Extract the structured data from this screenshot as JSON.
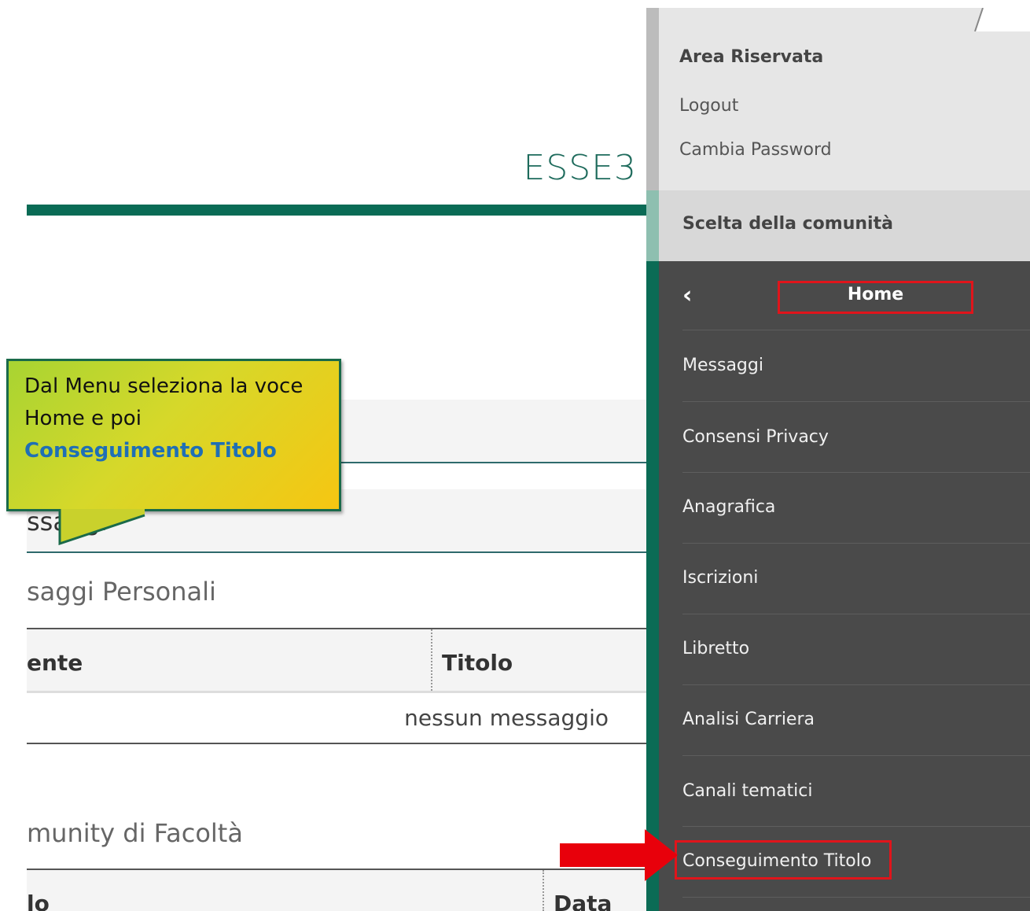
{
  "header": {
    "site_title": "ESSE3"
  },
  "main": {
    "section_heading": "ssaggi",
    "personal_heading": "saggi Personali",
    "table1": {
      "col_sender": "ente",
      "col_title": "Titolo",
      "empty": "nessun messaggio"
    },
    "community_heading": "munity di Facoltà",
    "table2": {
      "col_title": "lo",
      "col_date": "Data"
    }
  },
  "callout": {
    "text": "Dal Menu seleziona la voce Home e poi",
    "highlight": "Conseguimento Titolo"
  },
  "sidebar": {
    "area_title": "Area Riservata",
    "logout": "Logout",
    "change_password": "Cambia Password",
    "community": "Scelta della comunità",
    "back_icon": "‹",
    "home": "Home",
    "items": [
      {
        "label": "Messaggi"
      },
      {
        "label": "Consensi Privacy"
      },
      {
        "label": "Anagrafica"
      },
      {
        "label": "Iscrizioni"
      },
      {
        "label": "Libretto"
      },
      {
        "label": "Analisi Carriera"
      },
      {
        "label": "Canali tematici"
      },
      {
        "label": "Conseguimento Titolo"
      }
    ]
  },
  "colors": {
    "accent_green": "#0a6b55",
    "highlight_red": "#e0141b",
    "link_blue": "#1f6fb5",
    "sidebar_dark": "#4a4a4a"
  }
}
